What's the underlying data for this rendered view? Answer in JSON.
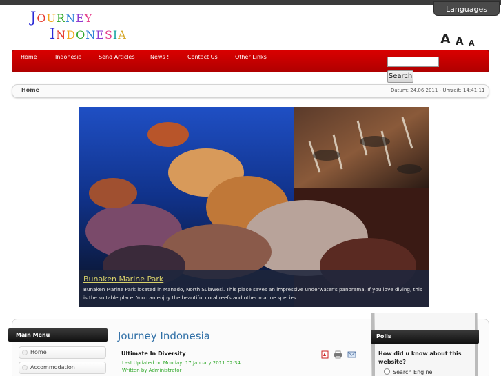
{
  "header": {
    "languages_label": "Languages",
    "logo": {
      "line1_cap": "J",
      "line1_rest": "OURNEY",
      "line2_cap": "I",
      "line2_rest": "NDONESIA"
    },
    "font_size_controls": [
      "A",
      "A",
      "A"
    ]
  },
  "nav": {
    "items": [
      "Home",
      "Indonesia",
      "Send Articles",
      "News !",
      "Contact Us",
      "Other Links"
    ],
    "search_button": "Search",
    "accent_color": "#c40000"
  },
  "breadcrumb": {
    "home": "Home",
    "datetime": "Datum: 24.06.2011 - Uhrzeit: 14:41:11"
  },
  "slideshow": {
    "title": "Bunaken Marine Park",
    "text": "Bunaken Marine Park located in Manado, North Sulawesi. This place saves an impressive underwater's panorama. If you love diving, this is the suitable place. You can enjoy the beautiful coral reefs and other marine species."
  },
  "sidebar_left": {
    "title": "Main Menu",
    "items": [
      "Home",
      "Accommodation"
    ]
  },
  "main": {
    "heading": "Journey Indonesia",
    "article": {
      "title": "Ultimate In Diversity",
      "last_updated": "Last Updated on Monday, 17 January 2011 02:34",
      "author": "Written by Administrator"
    },
    "article_icons": [
      "pdf-icon",
      "print-icon",
      "email-icon"
    ]
  },
  "sidebar_right": {
    "title": "Polls",
    "question": "How did u know about this website?",
    "options": [
      "Search Engine"
    ]
  }
}
